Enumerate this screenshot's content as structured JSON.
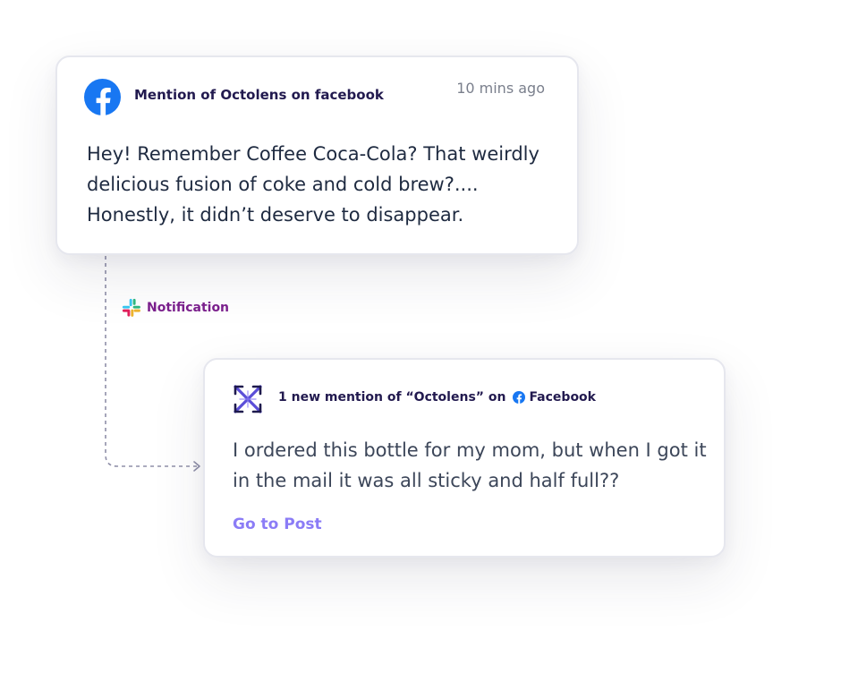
{
  "colors": {
    "facebook_blue": "#1877f2",
    "title_navy": "#221a4f",
    "body_text": "#1e2a40",
    "notification_purple": "#7a1f8c",
    "link_purple": "#8b7cf6",
    "octolens_purple": "#5b4ed8",
    "connector_gray": "#8f8fa8"
  },
  "mention_card": {
    "icon": "facebook-icon",
    "title": "Mention of Octolens on facebook",
    "timestamp": "10 mins ago",
    "body": "Hey! Remember Coffee Coca-Cola? That weirdly delicious fusion of coke and cold brew?.... Honestly, it didn’t deserve to disappear."
  },
  "connector": {
    "icon": "slack-icon",
    "label": "Notification"
  },
  "notification_card": {
    "icon": "octolens-logo-icon",
    "title_prefix": "1 new mention of “Octolens” on",
    "platform_icon": "facebook-icon",
    "platform": "Facebook",
    "body": "I ordered this bottle for my mom, but when I got it in the mail it was all sticky and half full??",
    "link": "Go to Post"
  }
}
